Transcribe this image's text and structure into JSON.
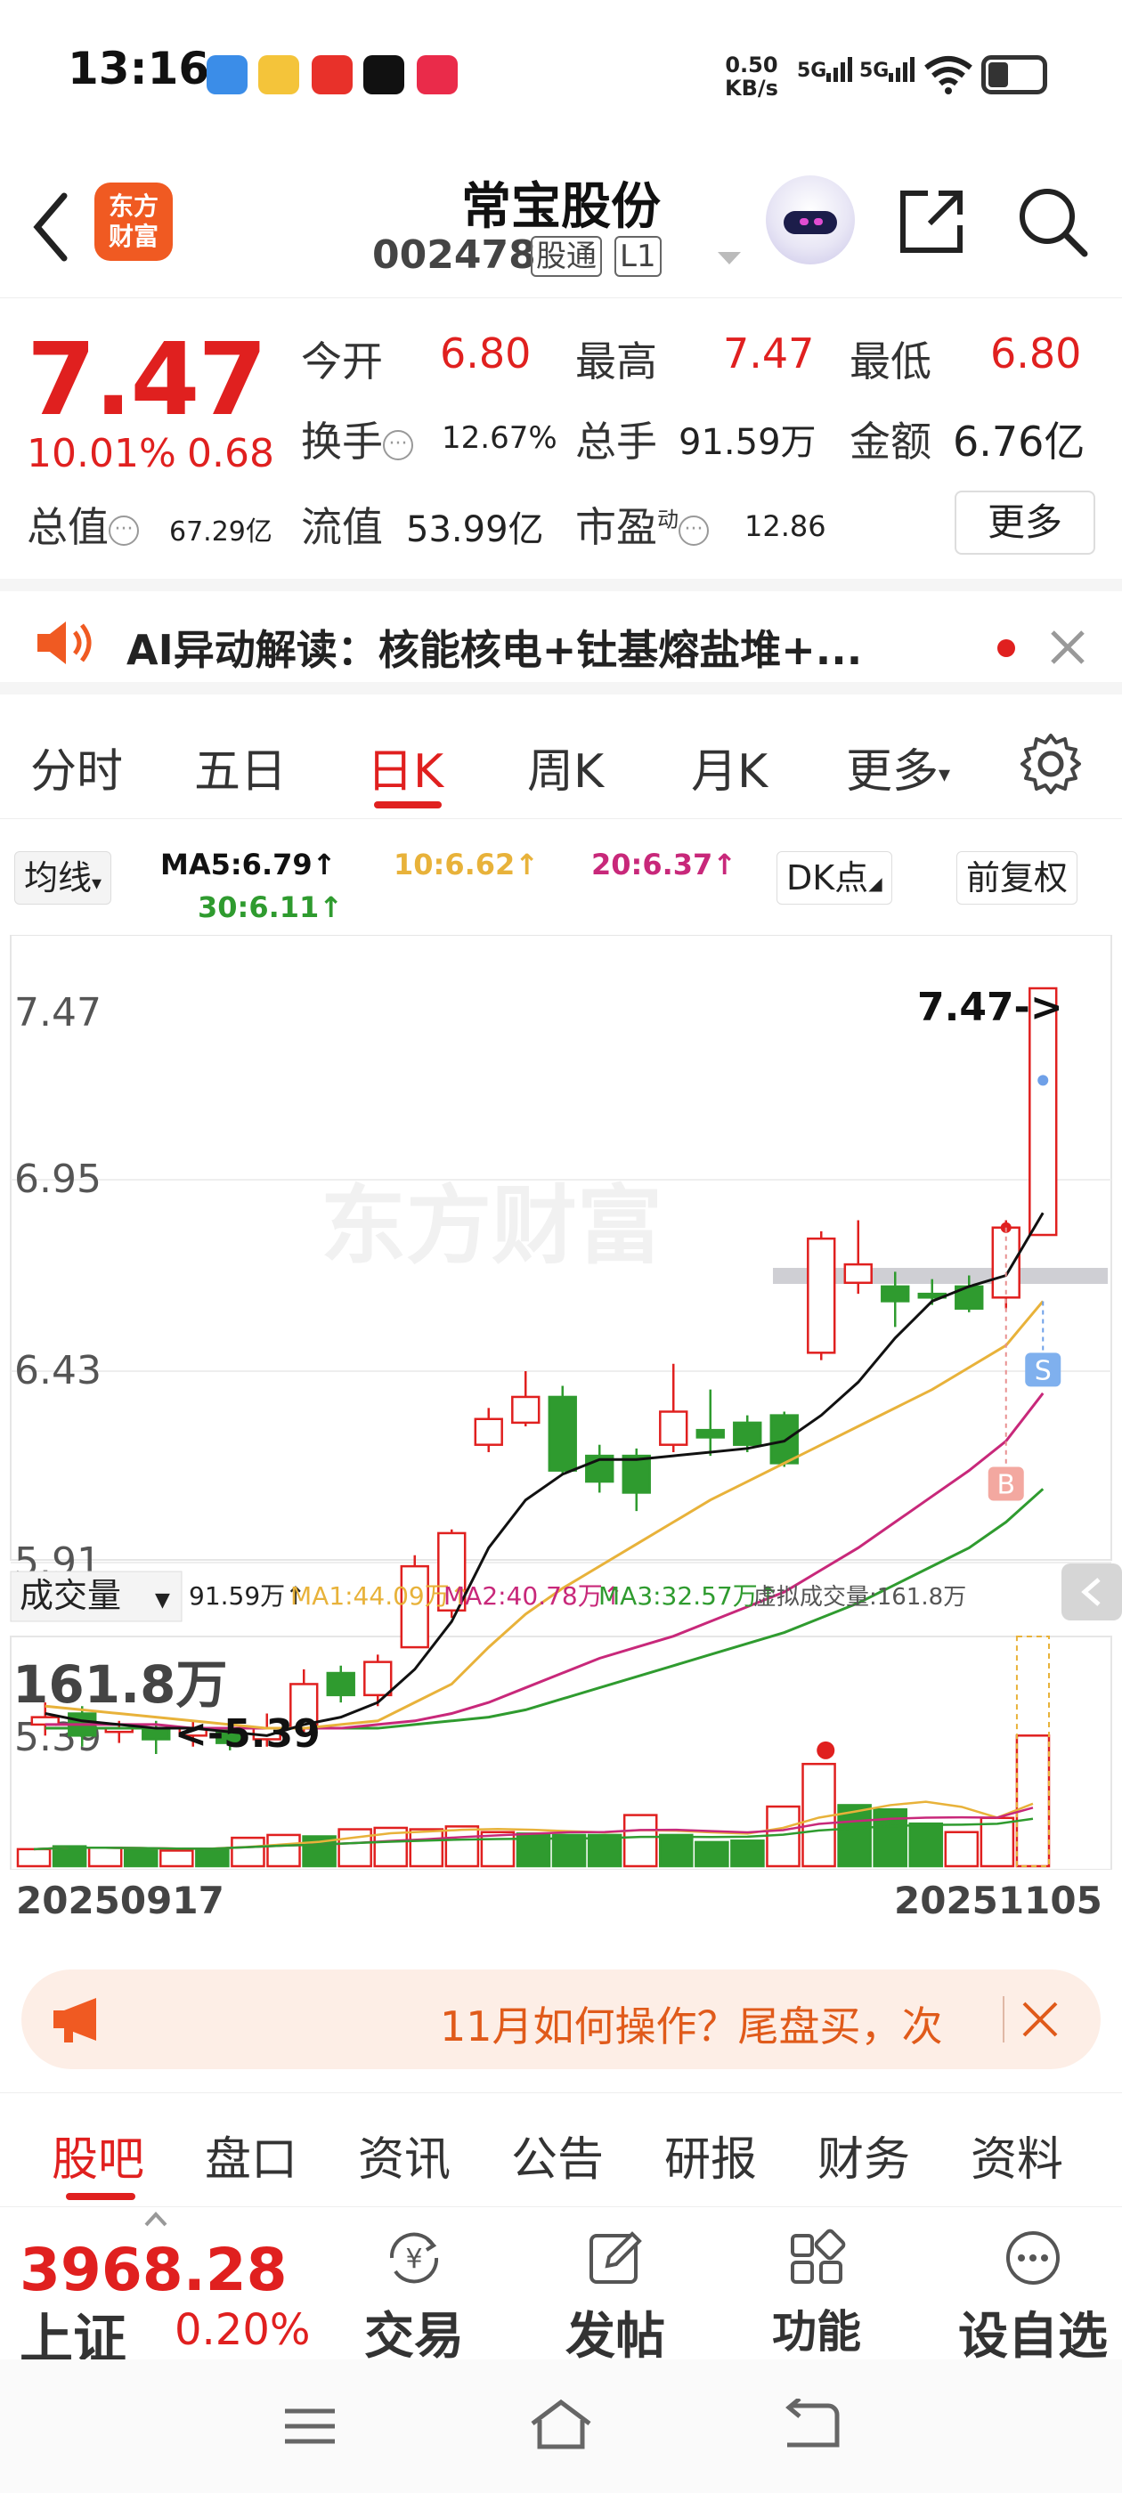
{
  "status_bar": {
    "time": "13:16",
    "network_speed": "0.50",
    "network_unit": "KB/s",
    "signal1": "5G",
    "signal2": "5G"
  },
  "header": {
    "app_logo": "东方\n财富",
    "stock_name": "常宝股份",
    "stock_code": "002478",
    "tag1": "股通",
    "tag2": "L1"
  },
  "quote": {
    "price": "7.47",
    "change_pct": "10.01%",
    "change_amt": "0.68",
    "open_label": "今开",
    "open": "6.80",
    "high_label": "最高",
    "high": "7.47",
    "low_label": "最低",
    "low": "6.80",
    "turnover_label": "换手",
    "turnover": "12.67%",
    "volume_label": "总手",
    "volume": "91.59万",
    "amount_label": "金额",
    "amount": "6.76亿",
    "mktcap_label": "总值",
    "mktcap": "67.29亿",
    "float_label": "流值",
    "float_cap": "53.99亿",
    "pe_label": "市盈",
    "pe_sup": "动",
    "pe": "12.86",
    "more": "更多"
  },
  "ai_bar": {
    "text": "AI异动解读：核能核电+钍基熔盐堆+..."
  },
  "chart_tabs": {
    "items": [
      "分时",
      "五日",
      "日K",
      "周K",
      "月K",
      "更多"
    ],
    "active": 2
  },
  "ma_legend": {
    "select": "均线",
    "ma5": "MA5:6.79↑",
    "ma10": "10:6.62↑",
    "ma20": "20:6.37↑",
    "ma30": "30:6.11↑",
    "dk": "DK点",
    "fq": "前复权"
  },
  "chart_data": {
    "type": "candlestick",
    "y_ticks": [
      "7.47",
      "6.95",
      "6.43",
      "5.91",
      "5.39"
    ],
    "ylim": [
      5.39,
      7.47
    ],
    "max_label": "7.47->",
    "min_label": "<-5.39",
    "buy_marker": "B",
    "sell_marker": "S",
    "candles": [
      {
        "o": 5.47,
        "c": 5.49,
        "h": 5.53,
        "l": 5.44
      },
      {
        "o": 5.5,
        "c": 5.44,
        "h": 5.52,
        "l": 5.41
      },
      {
        "o": 5.45,
        "c": 5.46,
        "h": 5.48,
        "l": 5.42
      },
      {
        "o": 5.46,
        "c": 5.43,
        "h": 5.48,
        "l": 5.39
      },
      {
        "o": 5.44,
        "c": 5.46,
        "h": 5.48,
        "l": 5.41
      },
      {
        "o": 5.46,
        "c": 5.42,
        "h": 5.48,
        "l": 5.4
      },
      {
        "o": 5.43,
        "c": 5.46,
        "h": 5.5,
        "l": 5.41
      },
      {
        "o": 5.46,
        "c": 5.58,
        "h": 5.62,
        "l": 5.45
      },
      {
        "o": 5.61,
        "c": 5.55,
        "h": 5.63,
        "l": 5.53
      },
      {
        "o": 5.55,
        "c": 5.64,
        "h": 5.66,
        "l": 5.52
      },
      {
        "o": 5.68,
        "c": 5.9,
        "h": 5.93,
        "l": 5.68
      },
      {
        "o": 5.78,
        "c": 5.99,
        "h": 6.0,
        "l": 5.76
      },
      {
        "o": 6.23,
        "c": 6.3,
        "h": 6.33,
        "l": 6.21
      },
      {
        "o": 6.29,
        "c": 6.36,
        "h": 6.43,
        "l": 6.28
      },
      {
        "o": 6.36,
        "c": 6.16,
        "h": 6.39,
        "l": 6.15
      },
      {
        "o": 6.2,
        "c": 6.13,
        "h": 6.23,
        "l": 6.1
      },
      {
        "o": 6.2,
        "c": 6.1,
        "h": 6.22,
        "l": 6.05
      },
      {
        "o": 6.23,
        "c": 6.32,
        "h": 6.45,
        "l": 6.21
      },
      {
        "o": 6.27,
        "c": 6.25,
        "h": 6.38,
        "l": 6.2
      },
      {
        "o": 6.29,
        "c": 6.23,
        "h": 6.31,
        "l": 6.21
      },
      {
        "o": 6.31,
        "c": 6.18,
        "h": 6.32,
        "l": 6.17
      },
      {
        "o": 6.48,
        "c": 6.79,
        "h": 6.81,
        "l": 6.46
      },
      {
        "o": 6.67,
        "c": 6.72,
        "h": 6.84,
        "l": 6.64
      },
      {
        "o": 6.66,
        "c": 6.62,
        "h": 6.7,
        "l": 6.55
      },
      {
        "o": 6.64,
        "c": 6.63,
        "h": 6.68,
        "l": 6.61
      },
      {
        "o": 6.66,
        "c": 6.6,
        "h": 6.69,
        "l": 6.59
      },
      {
        "o": 6.63,
        "c": 6.82,
        "h": 6.84,
        "l": 6.6
      },
      {
        "o": 6.8,
        "c": 7.47,
        "h": 7.47,
        "l": 6.8
      }
    ],
    "ma5": [
      5.5,
      5.48,
      5.47,
      5.46,
      5.46,
      5.45,
      5.44,
      5.47,
      5.49,
      5.53,
      5.62,
      5.75,
      5.95,
      6.08,
      6.15,
      6.19,
      6.19,
      6.2,
      6.21,
      6.22,
      6.24,
      6.31,
      6.4,
      6.52,
      6.62,
      6.66,
      6.69,
      6.86
    ],
    "ma10": [
      5.52,
      5.51,
      5.5,
      5.49,
      5.48,
      5.47,
      5.46,
      5.46,
      5.47,
      5.48,
      5.53,
      5.58,
      5.68,
      5.77,
      5.84,
      5.9,
      5.96,
      6.02,
      6.08,
      6.13,
      6.18,
      6.23,
      6.28,
      6.33,
      6.38,
      6.44,
      6.5,
      6.62
    ],
    "ma20": [
      5.47,
      5.47,
      5.47,
      5.47,
      5.46,
      5.46,
      5.46,
      5.46,
      5.46,
      5.47,
      5.48,
      5.5,
      5.53,
      5.57,
      5.61,
      5.65,
      5.68,
      5.71,
      5.75,
      5.79,
      5.83,
      5.89,
      5.95,
      6.02,
      6.09,
      6.16,
      6.24,
      6.37
    ],
    "ma30": [
      5.46,
      5.46,
      5.46,
      5.46,
      5.46,
      5.46,
      5.46,
      5.46,
      5.46,
      5.46,
      5.47,
      5.48,
      5.49,
      5.51,
      5.54,
      5.57,
      5.6,
      5.63,
      5.66,
      5.69,
      5.72,
      5.76,
      5.8,
      5.85,
      5.9,
      5.95,
      6.02,
      6.11
    ],
    "volume_title": "成交量",
    "volume_legend": "91.59万↑",
    "vma1": "MA1:44.09万↑",
    "vma2": "MA2:40.78万↑",
    "vma3": "MA3:32.57万↑",
    "virtual_vol": "虚拟成交量:161.8万",
    "vol_max_label": "161.8万",
    "vol_max": 161.8,
    "volumes": [
      12,
      14,
      13,
      12,
      11,
      12,
      20,
      22,
      21,
      26,
      27,
      26,
      28,
      24,
      23,
      22,
      22,
      36,
      22,
      17,
      18,
      42,
      72,
      43,
      40,
      30,
      24,
      34,
      92
    ],
    "x_start": "20250917",
    "x_end": "20251105"
  },
  "ad_bar": {
    "text": "11月如何操作？尾盘买，次"
  },
  "footer_tabs": {
    "items": [
      "股吧",
      "盘口",
      "资讯",
      "公告",
      "研报",
      "财务",
      "资料"
    ]
  },
  "bottom_bar": {
    "index_value": "3968.28",
    "index_name": "上证",
    "index_pct": "0.20%",
    "trade": "交易",
    "post": "发帖",
    "function": "功能",
    "watchlist": "设自选"
  },
  "colors": {
    "up": "#e0201f",
    "down": "#2f9b2f",
    "ma5": "#111111",
    "ma10": "#e8b23a",
    "ma20": "#c8287a",
    "ma30": "#2f9b2f"
  }
}
